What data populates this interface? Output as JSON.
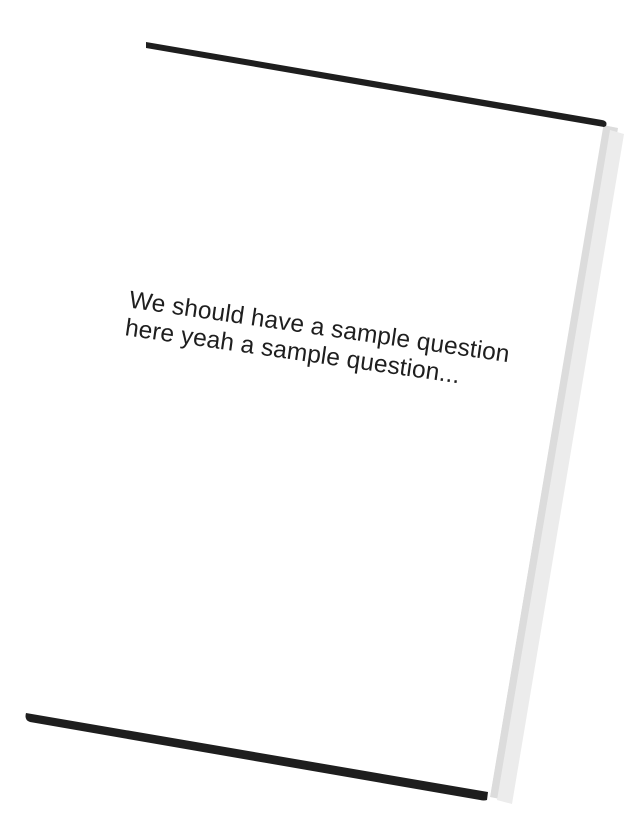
{
  "card": {
    "question_line_1": "We should have a sample question",
    "question_line_2": "here yeah a sample question..."
  },
  "colors": {
    "card_fill": "#ffffff",
    "card_edge": "#1e1e1e",
    "card_shadow": "#d9d9d9",
    "text": "#1e1e1e"
  }
}
